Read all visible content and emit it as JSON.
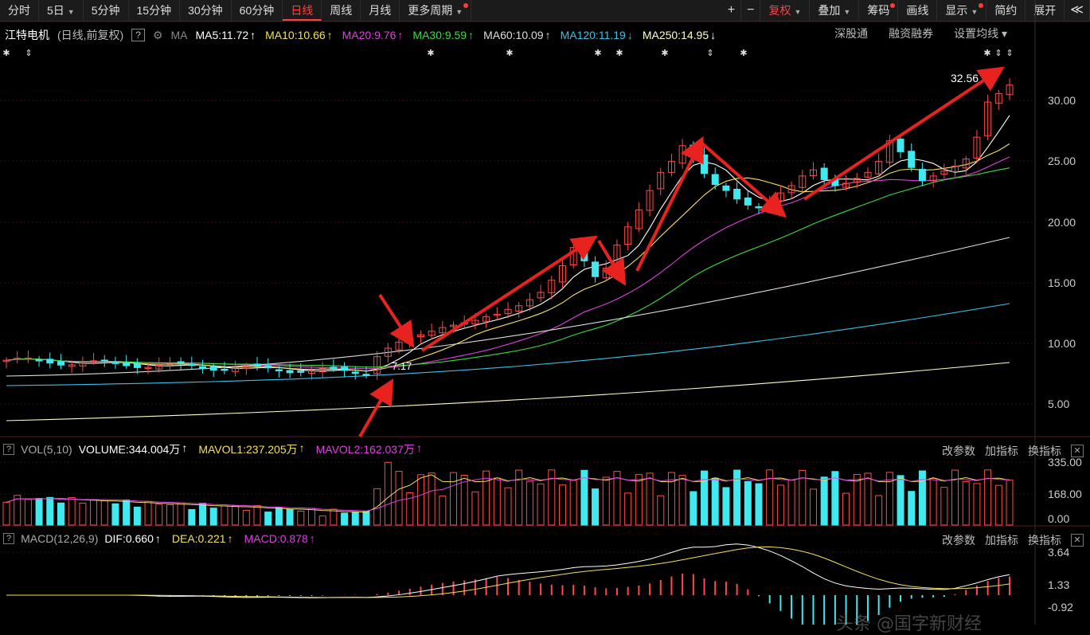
{
  "toolbar": {
    "left": [
      {
        "label": "分时",
        "dropdown": false
      },
      {
        "label": "5日",
        "dropdown": true
      },
      {
        "label": "5分钟",
        "dropdown": false
      },
      {
        "label": "15分钟",
        "dropdown": false
      },
      {
        "label": "30分钟",
        "dropdown": false
      },
      {
        "label": "60分钟",
        "dropdown": false
      },
      {
        "label": "日线",
        "dropdown": false,
        "active": true
      },
      {
        "label": "周线",
        "dropdown": false
      },
      {
        "label": "月线",
        "dropdown": false
      },
      {
        "label": "更多周期",
        "dropdown": true,
        "dot": true
      }
    ],
    "right": [
      {
        "label": "+",
        "icon": true
      },
      {
        "label": "−",
        "icon": true
      },
      {
        "label": "复权",
        "dropdown": true,
        "red": true
      },
      {
        "label": "叠加",
        "dropdown": true
      },
      {
        "label": "筹码",
        "dot": true
      },
      {
        "label": "画线"
      },
      {
        "label": "显示",
        "dropdown": true,
        "dot": true
      },
      {
        "label": "简约"
      },
      {
        "label": "展开"
      },
      {
        "label": "≪",
        "icon": true
      }
    ]
  },
  "info": {
    "stock_name": "江特电机",
    "mode": "(日线,前复权)",
    "help": "?",
    "ma_label": "MA",
    "ma": [
      {
        "text": "MA5:11.72",
        "arrow": "↑",
        "color": "#ffffff"
      },
      {
        "text": "MA10:10.66",
        "arrow": "↑",
        "color": "#f5e05a"
      },
      {
        "text": "MA20:9.76",
        "arrow": "↑",
        "color": "#e040e0"
      },
      {
        "text": "MA30:9.59",
        "arrow": "↑",
        "color": "#3ddc3d"
      },
      {
        "text": "MA60:10.09",
        "arrow": "↑",
        "color": "#dddddd"
      },
      {
        "text": "MA120:11.19",
        "arrow": "↓",
        "color": "#3cc0e8"
      },
      {
        "text": "MA250:14.95",
        "arrow": "↓",
        "color": "#ffffc8"
      }
    ],
    "links": [
      "深股通",
      "融资融券",
      "设置均线"
    ]
  },
  "price_axis": [
    "30.00",
    "25.00",
    "20.00",
    "15.00",
    "10.00",
    "5.00"
  ],
  "annotations": {
    "high": "32.56",
    "low": "7.17"
  },
  "volume": {
    "title": "VOL(5,10)",
    "fields": [
      {
        "text": "VOLUME:344.004万",
        "arrow": "↑",
        "color": "#ffffff"
      },
      {
        "text": "MAVOL1:237.205万",
        "arrow": "↑",
        "color": "#f5e05a"
      },
      {
        "text": "MAVOL2:162.037万",
        "arrow": "↑",
        "color": "#e040e0"
      }
    ],
    "axis": [
      "335.00",
      "168.00",
      "0.00"
    ]
  },
  "macd": {
    "title": "MACD(12,26,9)",
    "fields": [
      {
        "text": "DIF:0.660",
        "arrow": "↑",
        "color": "#ffffff"
      },
      {
        "text": "DEA:0.221",
        "arrow": "↑",
        "color": "#f5e05a"
      },
      {
        "text": "MACD:0.878",
        "arrow": "↑",
        "color": "#e040e0"
      }
    ],
    "axis": [
      "3.64",
      "1.33",
      "-0.92"
    ]
  },
  "panel_actions": [
    "改参数",
    "加指标",
    "换指标"
  ],
  "panel_close": "✕",
  "watermark": "头条 @国字新财经",
  "colors": {
    "up": "#ff4a4a",
    "down": "#40e8f0",
    "bg": "#000000",
    "arrow": "#e8231f"
  }
}
